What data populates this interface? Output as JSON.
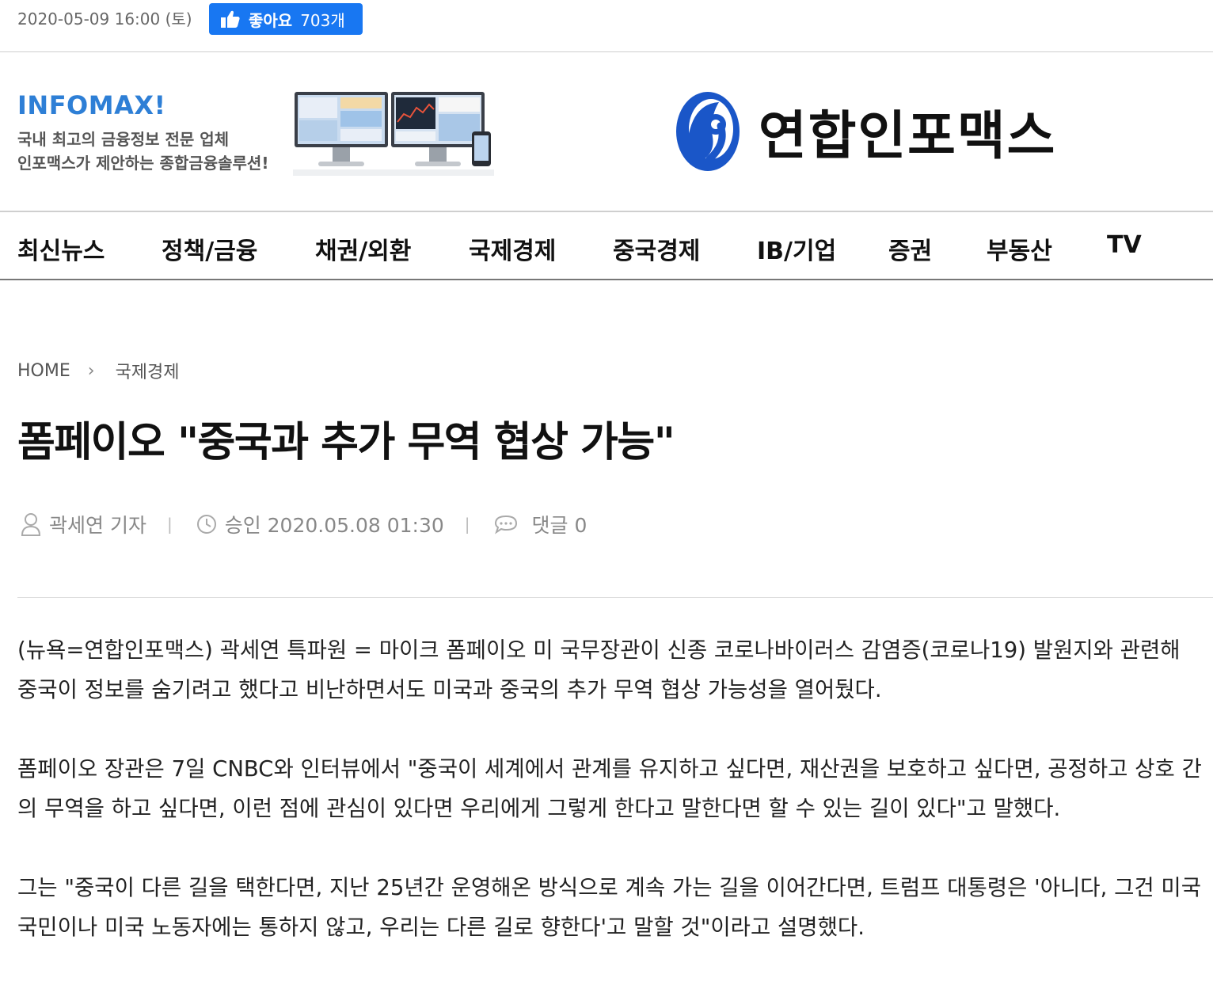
{
  "meta": {
    "date": "2020-05-09 16:00 (토)",
    "like_label": "좋아요",
    "like_count": "703개"
  },
  "ad": {
    "title": "INFOMAX!",
    "line1": "국내 최고의 금융정보 전문 업체",
    "line2": "인포맥스가 제안하는 종합금융솔루션!"
  },
  "logo": {
    "text": "연합인포맥스",
    "brand_color": "#1a56c8"
  },
  "nav": {
    "items": [
      "최신뉴스",
      "정책/금융",
      "채권/외환",
      "국제경제",
      "중국경제",
      "IB/기업",
      "증권",
      "부동산",
      "TV"
    ]
  },
  "breadcrumb": {
    "home": "HOME",
    "current": "국제경제"
  },
  "article": {
    "title": "폼페이오 \"중국과 추가 무역 협상 가능\"",
    "author": "곽세연 기자",
    "approved": "승인 2020.05.08 01:30",
    "comments": "댓글 0",
    "paragraphs": [
      "(뉴욕=연합인포맥스) 곽세연 특파원 = 마이크 폼페이오 미 국무장관이 신종 코로나바이러스 감염증(코로나19) 발원지와 관련해 중국이 정보를 숨기려고 했다고 비난하면서도 미국과 중국의 추가 무역 협상 가능성을 열어뒀다.",
      "폼페이오 장관은 7일 CNBC와 인터뷰에서 \"중국이 세계에서 관계를 유지하고 싶다면, 재산권을 보호하고 싶다면, 공정하고 상호 간의 무역을 하고 싶다면, 이런 점에 관심이 있다면 우리에게 그렇게 한다고 말한다면 할 수 있는 길이 있다\"고 말했다.",
      "그는 \"중국이 다른 길을 택한다면, 지난 25년간 운영해온 방식으로 계속 가는 길을 이어간다면, 트럼프 대통령은 '아니다, 그건 미국 국민이나 미국 노동자에는 통하지 않고, 우리는 다른 길로 향한다'고 말할 것\"이라고 설명했다."
    ]
  }
}
